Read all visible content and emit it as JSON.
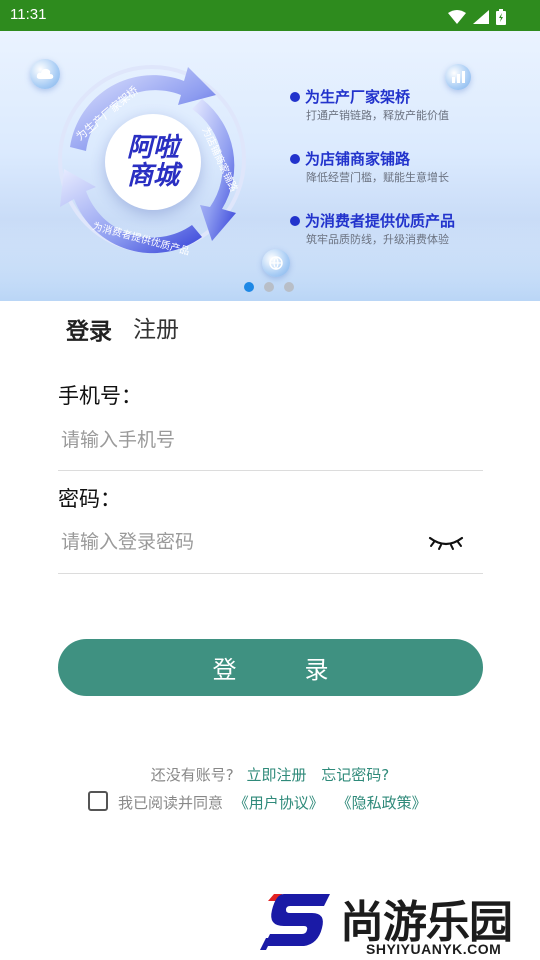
{
  "status_bar": {
    "time": "11:31"
  },
  "banner": {
    "center_line1": "阿啦",
    "center_line2": "商城",
    "ring_texts": [
      "为生产厂家架桥",
      "为店铺商家铺路",
      "为消费者提供优质产品"
    ],
    "bullets": [
      {
        "title": "为生产厂家架桥",
        "subtitle": "打通产销链路，释放产能价值"
      },
      {
        "title": "为店铺商家铺路",
        "subtitle": "降低经营门槛，赋能生意增长"
      },
      {
        "title": "为消费者提供优质产品",
        "subtitle": "筑牢品质防线，升级消费体验"
      }
    ],
    "page_count": 3,
    "active_page": 1
  },
  "tabs": {
    "login": "登录",
    "register": "注册"
  },
  "form": {
    "phone_label": "手机号：",
    "phone_placeholder": "请输入手机号",
    "phone_value": "",
    "password_label": "密码：",
    "password_placeholder": "请输入登录密码",
    "password_value": ""
  },
  "login_button": "登　录",
  "footer": {
    "no_account": "还没有账号?",
    "register_now": "立即注册",
    "forgot_password": "忘记密码?",
    "agree_prefix": "我已阅读并同意",
    "user_agreement": "《用户协议》",
    "privacy_policy": "《隐私政策》",
    "agreed": false
  },
  "watermark": {
    "name": "尚游乐园",
    "url": "SHYIYUANYK.COM"
  },
  "colors": {
    "status_bar": "#2e8b1e",
    "accent": "#3f9181",
    "link": "#2f8a7a",
    "banner_blue": "#2233cc"
  }
}
